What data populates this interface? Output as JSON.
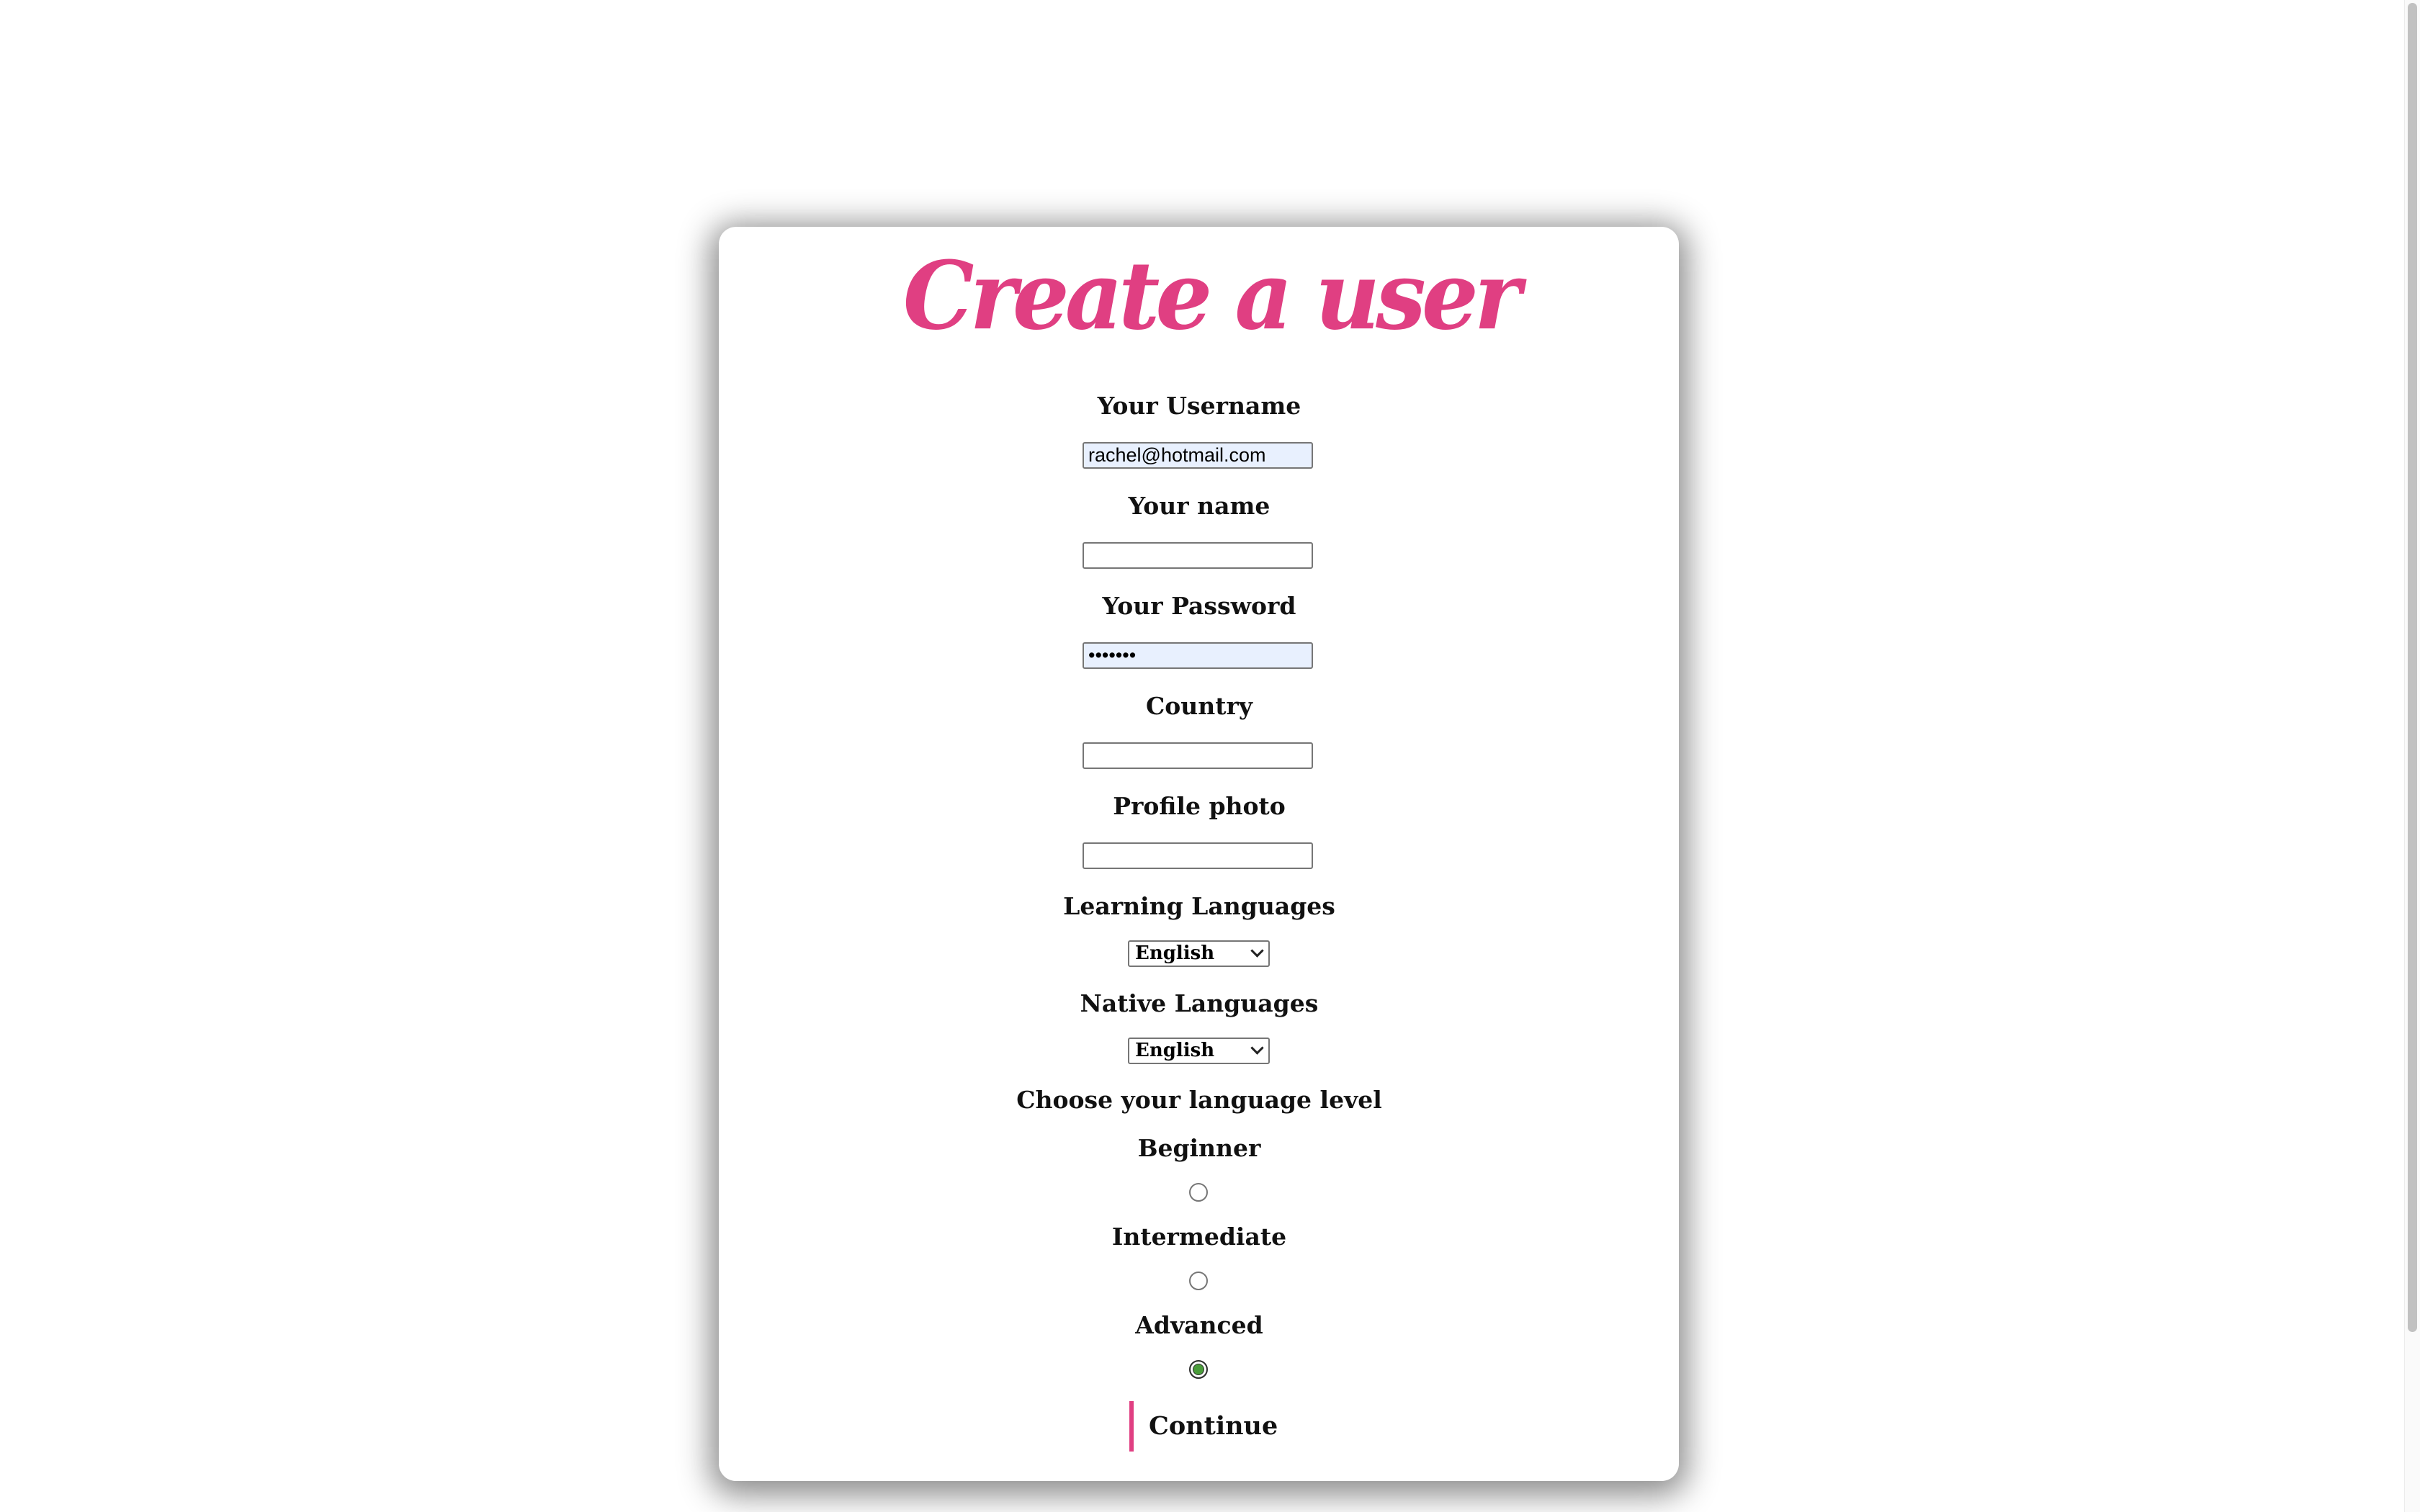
{
  "page": {
    "title": "Create a user"
  },
  "form": {
    "username": {
      "label": "Your Username",
      "value": "rachel@hotmail.com"
    },
    "name": {
      "label": "Your name",
      "value": ""
    },
    "password": {
      "label": "Your Password",
      "value": "•••••••"
    },
    "country": {
      "label": "Country",
      "value": ""
    },
    "profile_photo": {
      "label": "Profile photo",
      "value": ""
    },
    "learning_languages": {
      "label": "Learning Languages",
      "selected": "English"
    },
    "native_languages": {
      "label": "Native Languages",
      "selected": "English"
    },
    "level": {
      "label": "Choose your language level",
      "options": [
        {
          "label": "Beginner",
          "checked": false
        },
        {
          "label": "Intermediate",
          "checked": false
        },
        {
          "label": "Advanced",
          "checked": true
        }
      ]
    },
    "continue_label": "Continue"
  },
  "colors": {
    "accent": "#e03f82",
    "radio_checked": "#4a9c3a",
    "autofill_bg": "#e8f0fe"
  }
}
